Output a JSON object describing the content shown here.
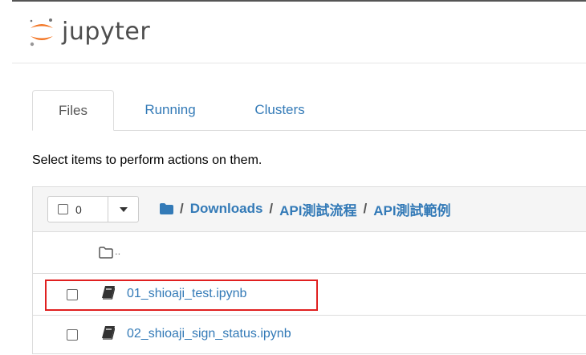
{
  "header": {
    "app_name": "jupyter"
  },
  "tabs": [
    {
      "label": "Files",
      "active": true
    },
    {
      "label": "Running",
      "active": false
    },
    {
      "label": "Clusters",
      "active": false
    }
  ],
  "hint": "Select items to perform actions on them.",
  "toolbar": {
    "selected_count": "0"
  },
  "breadcrumb": {
    "root": "/",
    "items": [
      "Downloads",
      "API測試流程",
      "API測試範例"
    ]
  },
  "files": {
    "parent": "..",
    "items": [
      {
        "name": "01_shioaji_test.ipynb",
        "highlighted": true
      },
      {
        "name": "02_shioaji_sign_status.ipynb",
        "highlighted": false
      }
    ]
  },
  "colors": {
    "link": "#337ab7",
    "highlight": "#e02020",
    "logo_orange": "#f37726"
  }
}
